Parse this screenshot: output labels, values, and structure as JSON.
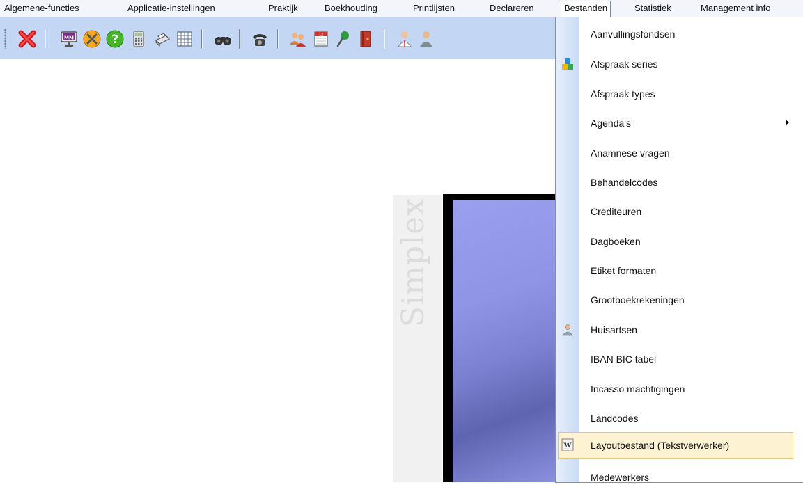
{
  "menubar": {
    "items": [
      {
        "label": "Algemene-functies"
      },
      {
        "label": "Applicatie-instellingen"
      },
      {
        "label": "Praktijk"
      },
      {
        "label": "Boekhouding"
      },
      {
        "label": "Printlijsten"
      },
      {
        "label": "Declareren"
      },
      {
        "label": "Bestanden"
      },
      {
        "label": "Statistiek"
      },
      {
        "label": "Management info"
      }
    ],
    "active": "Bestanden"
  },
  "toolbar": {
    "buttons": [
      {
        "icon": "close-red-x-icon"
      },
      {
        "icon": "monitor-mm-icon"
      },
      {
        "icon": "tools-icon"
      },
      {
        "icon": "help-icon"
      },
      {
        "icon": "calculator-icon"
      },
      {
        "icon": "printer-icon"
      },
      {
        "icon": "grid-table-icon"
      },
      {
        "icon": "binoculars-icon"
      },
      {
        "icon": "telephone-icon"
      },
      {
        "icon": "users-icon"
      },
      {
        "icon": "calendar-icon"
      },
      {
        "icon": "pushpin-icon"
      },
      {
        "icon": "book-icon"
      },
      {
        "icon": "doctor-icon"
      },
      {
        "icon": "person-icon"
      }
    ]
  },
  "splash": {
    "brand": "Simplex"
  },
  "dropdown": {
    "items": [
      {
        "label": "Aanvullingsfondsen",
        "icon": ""
      },
      {
        "label": "Afspraak series",
        "icon": "blocks-icon"
      },
      {
        "label": "Afspraak types",
        "icon": ""
      },
      {
        "label": "Agenda's",
        "icon": "",
        "submenu": true
      },
      {
        "label": "Anamnese vragen",
        "icon": ""
      },
      {
        "label": "Behandelcodes",
        "icon": ""
      },
      {
        "label": "Crediteuren",
        "icon": ""
      },
      {
        "label": "Dagboeken",
        "icon": ""
      },
      {
        "label": "Etiket formaten",
        "icon": ""
      },
      {
        "label": "Grootboekrekeningen",
        "icon": ""
      },
      {
        "label": "Huisartsen",
        "icon": "doctor-person-icon"
      },
      {
        "label": "IBAN BIC tabel",
        "icon": ""
      },
      {
        "label": "Incasso machtigingen",
        "icon": ""
      },
      {
        "label": "Landcodes",
        "icon": ""
      },
      {
        "label": "Layoutbestand (Tekstverwerker)",
        "icon": "word-document-icon",
        "highlighted": true
      },
      {
        "label": "Medewerkers",
        "icon": ""
      }
    ]
  }
}
